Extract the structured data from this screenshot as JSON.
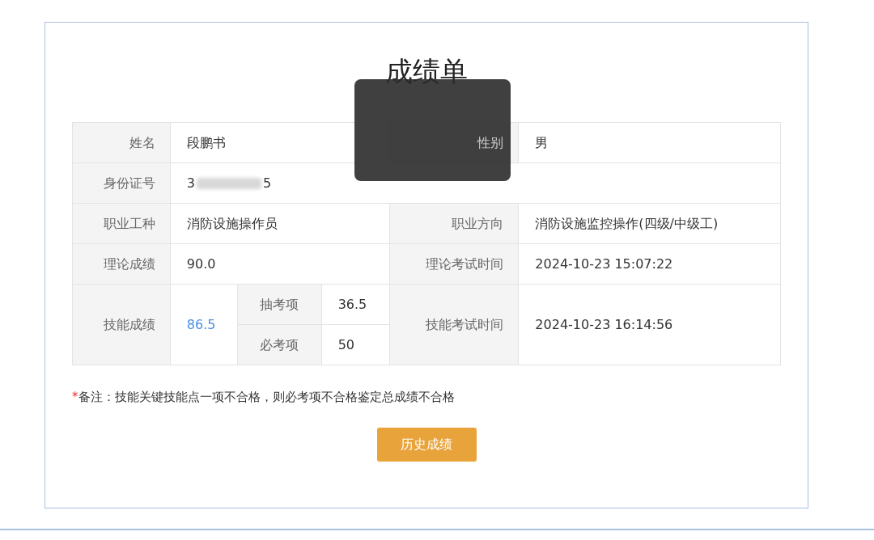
{
  "title": "成绩单",
  "info": [
    {
      "label": "姓名",
      "value": "段鹏书"
    },
    {
      "label": "性别",
      "value": "男"
    }
  ],
  "id_row": {
    "label": "身份证号",
    "value_start": "3",
    "value_end": "5"
  },
  "job": [
    {
      "label": "职业工种",
      "value": "消防设施操作员"
    },
    {
      "label": "职业方向",
      "value": "消防设施监控操作(四级/中级工)"
    }
  ],
  "theory": [
    {
      "label": "理论成绩",
      "value": "90.0"
    },
    {
      "label": "理论考试时间",
      "value": "2024-10-23 15:07:22"
    }
  ],
  "skill": {
    "label": "技能成绩",
    "total": "86.5",
    "parts": [
      {
        "label": "抽考项",
        "value": "36.5"
      },
      {
        "label": "必考项",
        "value": "50"
      }
    ],
    "time_label": "技能考试时间",
    "time": "2024-10-23 16:14:56"
  },
  "note": {
    "mark": "*",
    "text": "备注：技能关键技能点一项不合格，则必考项不合格鉴定总成绩不合格"
  },
  "button": "历史成绩"
}
